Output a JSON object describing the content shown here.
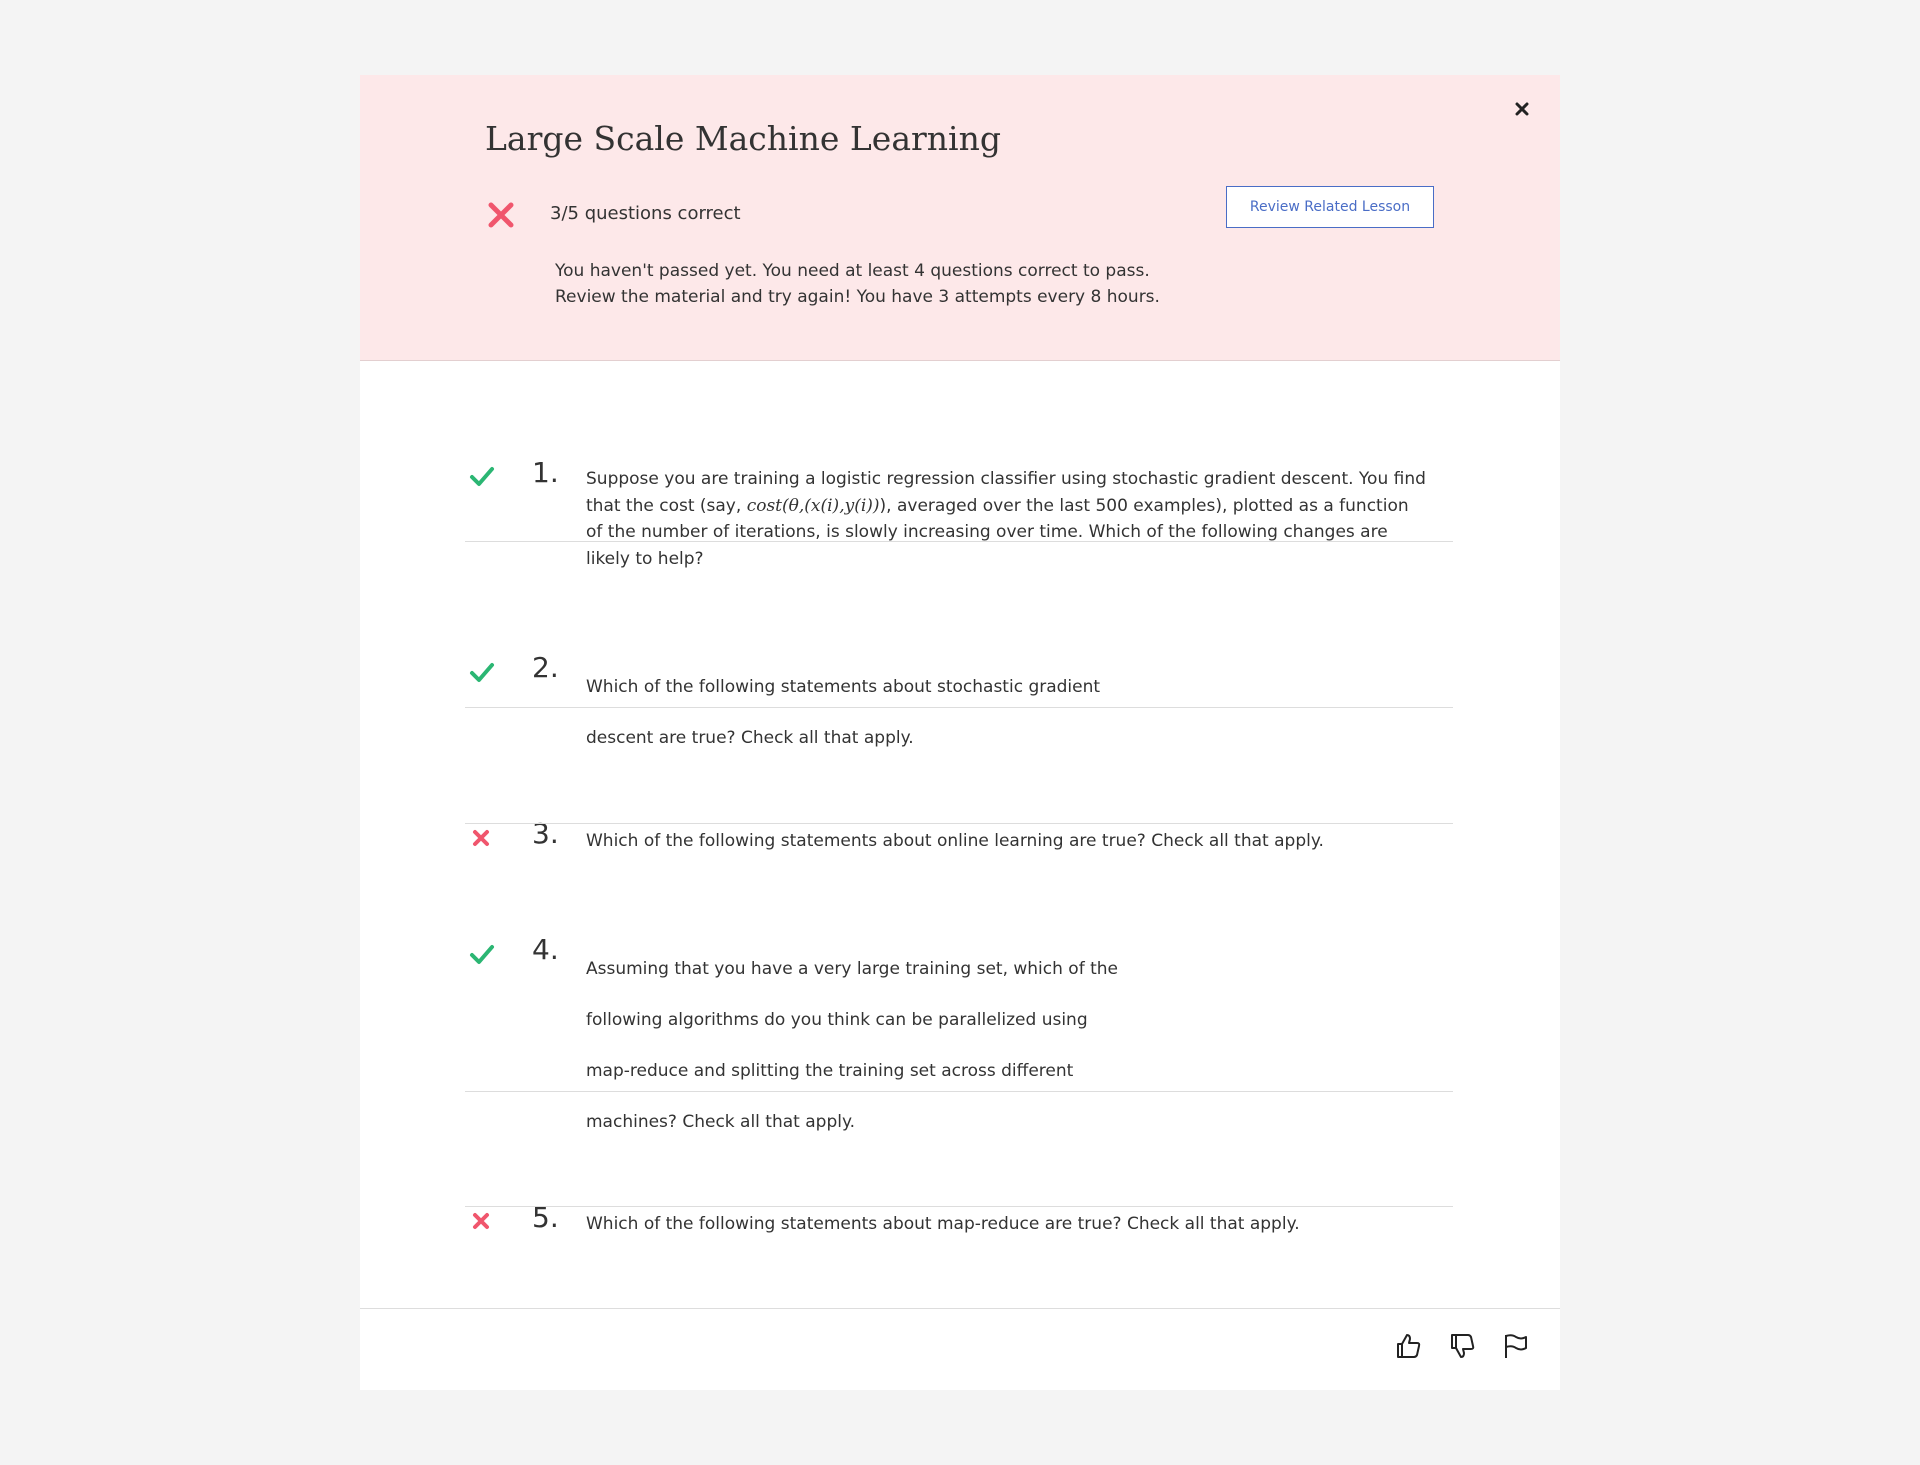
{
  "header": {
    "title": "Large Scale Machine Learning",
    "score": "3/5 questions correct",
    "review_button": "Review Related Lesson",
    "message_lines": [
      "You haven't passed yet. You need at least 4 questions correct to pass.",
      "Review the material and try again! You have 3 attempts every 8 hours."
    ],
    "status_icon": "cross-icon",
    "close_icon": "close-icon"
  },
  "questions": [
    {
      "number": "1.",
      "status": "correct",
      "lines": [
        "Suppose you are training a logistic regression classifier using stochastic gradient descent. You find",
        "that the cost (say, ",
        "cost(θ,(x(i),y(i))",
        "), averaged over the last 500 examples), plotted as a function",
        "of the number of iterations, is slowly increasing over time. Which of the following changes are",
        "likely to help?"
      ]
    },
    {
      "number": "2.",
      "status": "correct",
      "lines": [
        "Which of the following statements about stochastic gradient",
        "descent are true? Check all that apply."
      ]
    },
    {
      "number": "3.",
      "status": "incorrect",
      "lines": [
        "Which of the following statements about online learning are true? Check all that apply."
      ]
    },
    {
      "number": "4.",
      "status": "correct",
      "lines": [
        "Assuming that you have a very large training set, which of the",
        "following algorithms do you think can be parallelized using",
        "map-reduce and splitting the training set across different",
        "machines? Check all that apply."
      ]
    },
    {
      "number": "5.",
      "status": "incorrect",
      "lines": [
        "Which of the following statements about map-reduce are true? Check all that apply."
      ]
    }
  ],
  "colors": {
    "correct": "#2bb673",
    "incorrect": "#f0566d",
    "header_bg": "#fde8e9",
    "accent": "#4a6dc6"
  },
  "footer": {
    "icons": [
      "thumbs-up-icon",
      "thumbs-down-icon",
      "flag-icon"
    ]
  }
}
